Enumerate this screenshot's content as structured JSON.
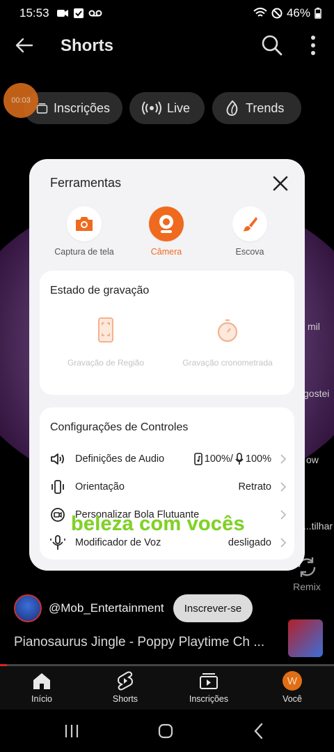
{
  "status_bar": {
    "time": "15:53",
    "battery": "46%"
  },
  "app_bar": {
    "title": "Shorts"
  },
  "recording_timer": "00:03",
  "chips": [
    {
      "label": "Inscrições",
      "icon": "subscriptions-icon"
    },
    {
      "label": "Live",
      "icon": "live-icon"
    },
    {
      "label": "Trends",
      "icon": "trending-icon"
    }
  ],
  "right_rail": {
    "likes": "mil",
    "dislike": "gostei",
    "remix_short": "ow",
    "share": "...tilhar",
    "remix": "Remix"
  },
  "dialog": {
    "title": "Ferramentas",
    "tools": [
      {
        "label": "Captura de tela",
        "icon": "screenshot-camera-icon",
        "active": false
      },
      {
        "label": "Câmera",
        "icon": "webcam-icon",
        "active": true
      },
      {
        "label": "Escova",
        "icon": "brush-icon",
        "active": false
      }
    ],
    "recording_state": {
      "title": "Estado de gravação",
      "options": [
        {
          "label": "Gravação de Região",
          "icon": "region-record-icon"
        },
        {
          "label": "Gravação cronometrada",
          "icon": "timer-icon"
        }
      ]
    },
    "controls": {
      "title": "Configurações de Controles",
      "rows": [
        {
          "label": "Definições de Audio",
          "value_system": "100%/",
          "value_mic": "100%",
          "icon": "speaker-icon"
        },
        {
          "label": "Orientação",
          "value": "Retrato",
          "icon": "orientation-icon"
        },
        {
          "label": "Personalizar Bola Flutuante",
          "value": "",
          "icon": "floating-ball-icon"
        },
        {
          "label": "Modificador de Voz",
          "value": "desligado",
          "icon": "voice-modifier-icon"
        }
      ]
    }
  },
  "caption": "beleza com vocês",
  "video": {
    "channel": "@Mob_Entertainment",
    "subscribe_label": "Inscrever-se",
    "title": "Pianosaurus Jingle - Poppy Playtime Ch ...",
    "progress": 0.02
  },
  "bottom_nav": [
    {
      "label": "Início",
      "icon": "home-icon"
    },
    {
      "label": "Shorts",
      "icon": "shorts-icon"
    },
    {
      "label": "Inscrições",
      "icon": "subscriptions-icon"
    },
    {
      "label": "Você",
      "icon": "avatar",
      "avatar_letter": "W"
    }
  ],
  "colors": {
    "accent": "#ef6a1f",
    "caption": "#7ed321",
    "progress": "#e02020"
  }
}
